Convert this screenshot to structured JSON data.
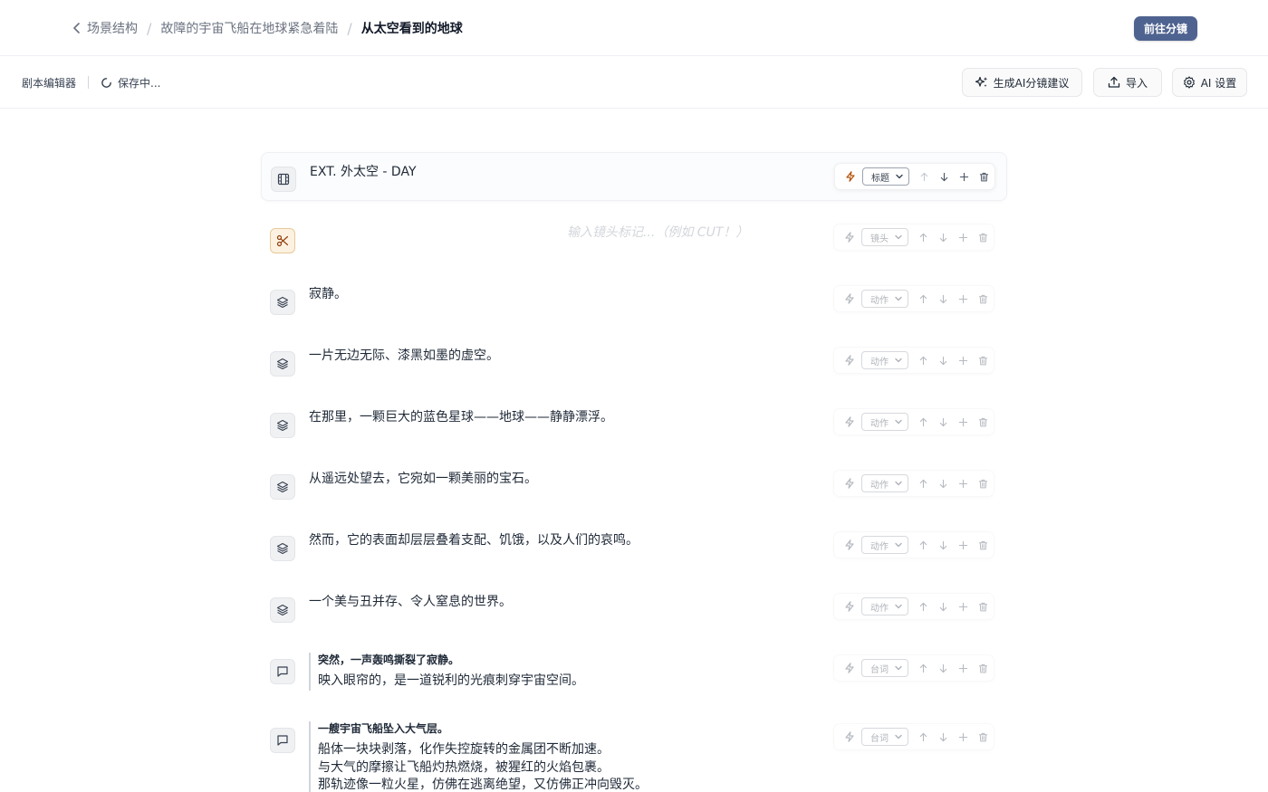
{
  "breadcrumb": {
    "items": [
      "场景结构",
      "故障的宇宙飞船在地球紧急着陆",
      "从太空看到的地球"
    ]
  },
  "header": {
    "goto_label": "前往分镜"
  },
  "toolbar": {
    "title": "剧本编辑器",
    "status": "保存中...",
    "ai_label": "生成AI分镜建议",
    "import_label": "导入",
    "settings_label": "AI 设置"
  },
  "rows": [
    {
      "kind": "heading",
      "icon": "film-icon",
      "text": "EXT. 外太空 - DAY",
      "type": "标题"
    },
    {
      "kind": "cut",
      "icon": "scissors-icon",
      "placeholder": "输入镜头标记...（例如 CUT！）",
      "type": "镜头"
    },
    {
      "kind": "action",
      "icon": "layers-icon",
      "text": "寂静。",
      "type": "动作"
    },
    {
      "kind": "action",
      "icon": "layers-icon",
      "text": "一片无边无际、漆黑如墨的虚空。",
      "type": "动作"
    },
    {
      "kind": "action",
      "icon": "layers-icon",
      "text": "在那里，一颗巨大的蓝色星球——地球——静静漂浮。",
      "type": "动作"
    },
    {
      "kind": "action",
      "icon": "layers-icon",
      "text": "从遥远处望去，它宛如一颗美丽的宝石。",
      "type": "动作"
    },
    {
      "kind": "action",
      "icon": "layers-icon",
      "text": "然而，它的表面却层层叠着支配、饥饿，以及人们的哀鸣。",
      "type": "动作"
    },
    {
      "kind": "action",
      "icon": "layers-icon",
      "text": "一个美与丑并存、令人窒息的世界。",
      "type": "动作"
    },
    {
      "kind": "dialogue",
      "icon": "message-icon",
      "character": "突然，一声轰鸣撕裂了寂静。",
      "lines": [
        "映入眼帘的，是一道锐利的光痕刺穿宇宙空间。"
      ],
      "type": "台词"
    },
    {
      "kind": "dialogue",
      "icon": "message-icon",
      "character": "一艘宇宙飞船坠入大气层。",
      "lines": [
        "船体一块块剥落，化作失控旋转的金属团不断加速。",
        "与大气的摩擦让飞船灼热燃烧，被猩红的火焰包裹。",
        "那轨迹像一粒火星，仿佛在逃离绝望，又仿佛正冲向毁灭。"
      ],
      "type": "台词"
    }
  ]
}
